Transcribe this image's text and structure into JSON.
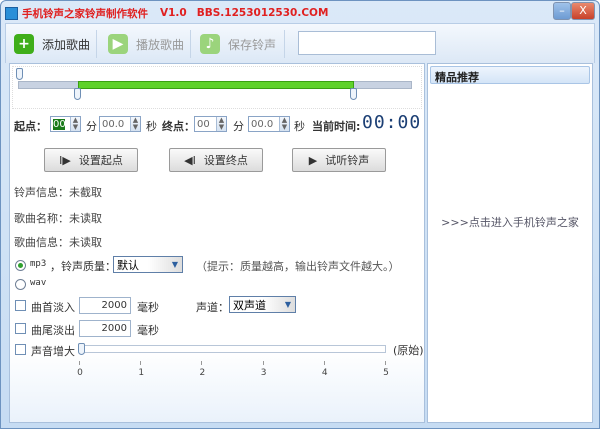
{
  "window": {
    "title": "手机铃声之家铃声制作软件",
    "version": "V1.0",
    "site": "BBS.1253012530.COM",
    "minimize": "–",
    "close": "X"
  },
  "toolbar": {
    "add": "添加歌曲",
    "play": "播放歌曲",
    "save": "保存铃声",
    "search_value": ""
  },
  "range": {
    "start_fraction": 0.15,
    "end_fraction": 0.85
  },
  "time": {
    "start_label": "起点：",
    "start_min": "00",
    "min_unit": "分",
    "start_sec": "00.0",
    "sec_unit": "秒",
    "end_label": "终点：",
    "end_min": "00",
    "end_sec": "00.0",
    "current_label": "当前时间:",
    "current": "00:00"
  },
  "buttons": {
    "set_start": "设置起点",
    "set_end": "设置终点",
    "preview": "试听铃声"
  },
  "info": {
    "ringtone": "铃声信息：未截取",
    "song_name": "歌曲名称：未读取",
    "song_info": "歌曲信息：未读取"
  },
  "format": {
    "mp3": "mp3",
    "quality_label": "，铃声质量：",
    "quality": "默认",
    "hint": "（提示：质量越高，输出铃声文件越大。）",
    "wav": "wav"
  },
  "fade": {
    "in_label": "曲首淡入",
    "in_value": "2000",
    "out_label": "曲尾淡出",
    "out_value": "2000",
    "unit": "毫秒",
    "channel_label": "声道：",
    "channel": "双声道"
  },
  "volume": {
    "label": "声音增大",
    "value": 0,
    "original": "(原始)",
    "ticks": [
      "0",
      "1",
      "2",
      "3",
      "4",
      "5"
    ]
  },
  "right": {
    "header": "精品推荐",
    "link": ">>>点击进入手机铃声之家"
  }
}
